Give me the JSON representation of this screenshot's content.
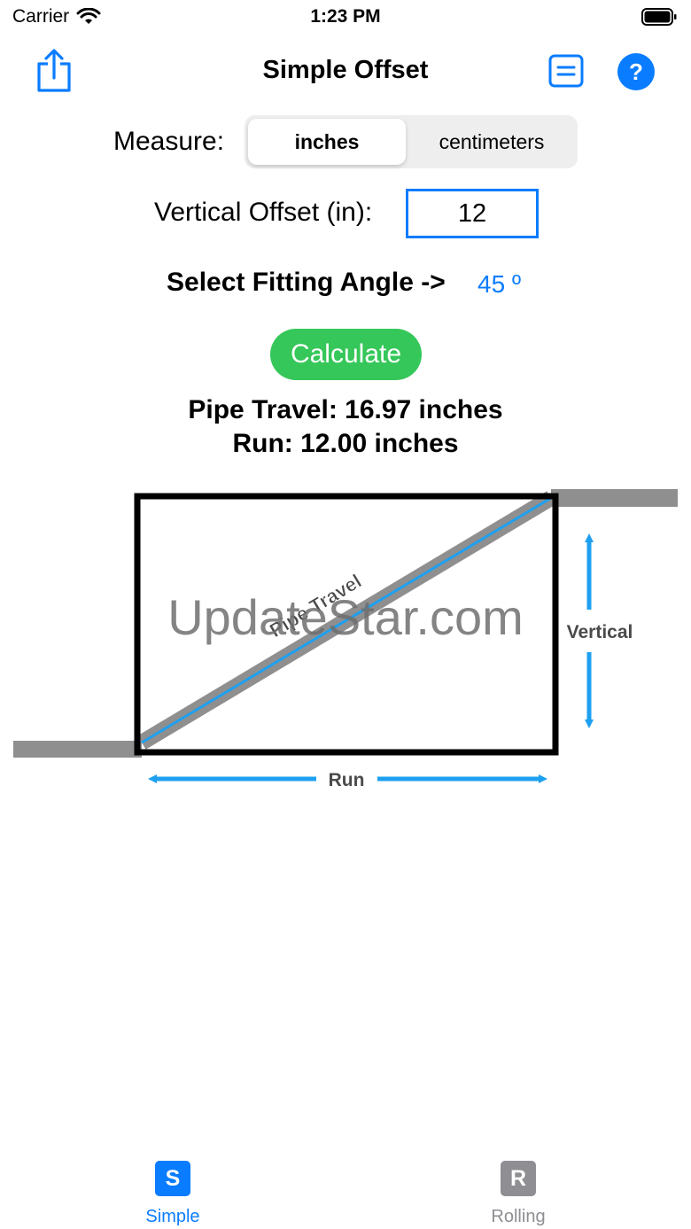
{
  "status_bar": {
    "carrier": "Carrier",
    "time": "1:23 PM"
  },
  "nav": {
    "title": "Simple Offset",
    "icons": [
      "share-icon",
      "list-icon",
      "help-icon"
    ],
    "help_symbol": "?"
  },
  "measure": {
    "label": "Measure:",
    "options": [
      "inches",
      "centimeters"
    ],
    "selected": "inches"
  },
  "offset": {
    "label": "Vertical Offset (in):",
    "value": "12"
  },
  "angle": {
    "label": "Select Fitting Angle ->",
    "value": "45 º"
  },
  "calculate_label": "Calculate",
  "results": {
    "travel": "Pipe Travel: 16.97 inches",
    "run": "Run: 12.00 inches"
  },
  "diagram": {
    "travel_label": "Pipe Travel",
    "vertical_label": "Vertical",
    "run_label": "Run",
    "watermark": "UpdateStar.com"
  },
  "tabs": [
    {
      "letter": "S",
      "label": "Simple",
      "active": true
    },
    {
      "letter": "R",
      "label": "Rolling",
      "active": false
    }
  ],
  "colors": {
    "accent": "#0a7cff",
    "calculate": "#35c759",
    "inactive_tab": "#8e8e93"
  }
}
